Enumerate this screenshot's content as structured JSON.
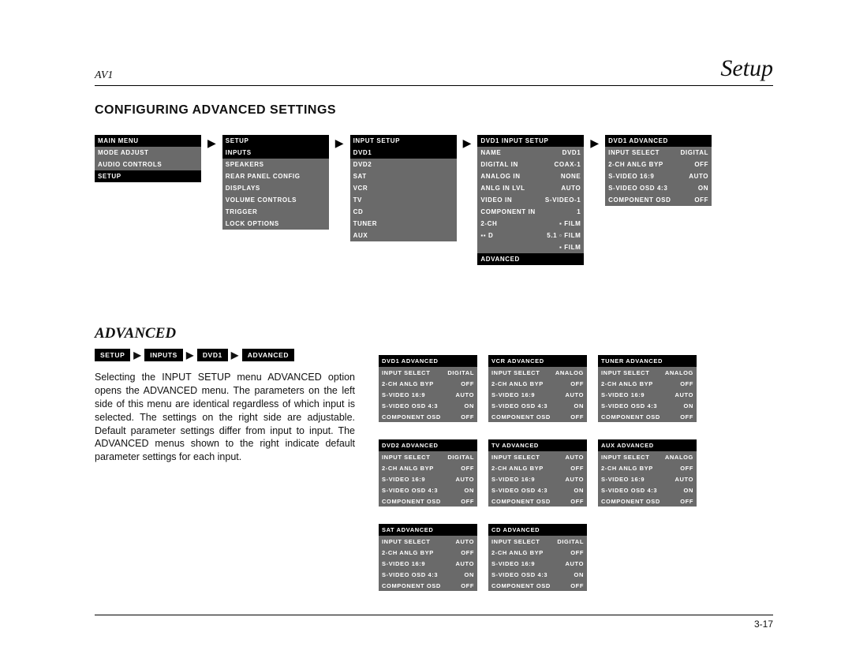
{
  "header": {
    "model": "AV1",
    "section": "Setup"
  },
  "title": "CONFIGURING ADVANCED SETTINGS",
  "breadcrumb": [
    "SETUP",
    "INPUTS",
    "DVD1",
    "ADVANCED"
  ],
  "paragraph": "Selecting the INPUT SETUP menu ADVANCED option opens the ADVANCED menu. The parameters on the left side of this menu are identical regardless of which input is selected. The settings on the right side are adjustable. Default parameter settings differ from input to input. The ADVANCED menus shown to the right indicate default parameter settings for each input.",
  "subheading": "ADVANCED",
  "page_number": "3-17",
  "menu_flow": [
    {
      "title": "MAIN MENU",
      "rows": [
        {
          "l": "MODE ADJUST"
        },
        {
          "l": "AUDIO CONTROLS"
        },
        {
          "l": "SETUP",
          "sel": true
        }
      ]
    },
    {
      "title": "SETUP",
      "rows": [
        {
          "l": "INPUTS",
          "sel": true
        },
        {
          "l": "SPEAKERS"
        },
        {
          "l": "REAR PANEL CONFIG"
        },
        {
          "l": "DISPLAYS"
        },
        {
          "l": "VOLUME CONTROLS"
        },
        {
          "l": "TRIGGER"
        },
        {
          "l": "LOCK OPTIONS"
        }
      ]
    },
    {
      "title": "INPUT SETUP",
      "rows": [
        {
          "l": "DVD1",
          "sel": true
        },
        {
          "l": "DVD2"
        },
        {
          "l": "SAT"
        },
        {
          "l": "VCR"
        },
        {
          "l": "TV"
        },
        {
          "l": "CD"
        },
        {
          "l": "TUNER"
        },
        {
          "l": "AUX"
        }
      ]
    },
    {
      "title": "DVD1 INPUT SETUP",
      "rows": [
        {
          "l": "NAME",
          "r": "DVD1"
        },
        {
          "l": "DIGITAL IN",
          "r": "COAX-1"
        },
        {
          "l": "ANALOG IN",
          "r": "NONE"
        },
        {
          "l": "ANLG IN LVL",
          "r": "AUTO"
        },
        {
          "l": "VIDEO IN",
          "r": "S-VIDEO-1"
        },
        {
          "l": "COMPONENT IN",
          "r": "1"
        },
        {
          "l": "2-CH",
          "r": "▪ FILM"
        },
        {
          "l": "▪▪ D",
          "r": "5.1 ▫ FILM"
        },
        {
          "l": "",
          "r": "▪ FILM"
        },
        {
          "l": "ADVANCED",
          "sel": true
        }
      ]
    },
    {
      "title": "DVD1 ADVANCED",
      "rows": [
        {
          "l": "INPUT SELECT",
          "r": "DIGITAL"
        },
        {
          "l": "2-CH ANLG BYP",
          "r": "OFF"
        },
        {
          "l": "S-VIDEO 16:9",
          "r": "AUTO"
        },
        {
          "l": "S-VIDEO OSD 4:3",
          "r": "ON"
        },
        {
          "l": "COMPONENT OSD",
          "r": "OFF"
        }
      ]
    }
  ],
  "adv_boxes": [
    {
      "title": "DVD1 ADVANCED",
      "rows": [
        {
          "l": "INPUT SELECT",
          "r": "DIGITAL"
        },
        {
          "l": "2-CH ANLG BYP",
          "r": "OFF"
        },
        {
          "l": "S-VIDEO 16:9",
          "r": "AUTO"
        },
        {
          "l": "S-VIDEO OSD 4:3",
          "r": "ON"
        },
        {
          "l": "COMPONENT OSD",
          "r": "OFF"
        }
      ]
    },
    {
      "title": "VCR ADVANCED",
      "rows": [
        {
          "l": "INPUT SELECT",
          "r": "ANALOG"
        },
        {
          "l": "2-CH ANLG BYP",
          "r": "OFF"
        },
        {
          "l": "S-VIDEO 16:9",
          "r": "AUTO"
        },
        {
          "l": "S-VIDEO OSD 4:3",
          "r": "ON"
        },
        {
          "l": "COMPONENT OSD",
          "r": "OFF"
        }
      ]
    },
    {
      "title": "TUNER ADVANCED",
      "rows": [
        {
          "l": "INPUT SELECT",
          "r": "ANALOG"
        },
        {
          "l": "2-CH ANLG BYP",
          "r": "OFF"
        },
        {
          "l": "S-VIDEO 16:9",
          "r": "AUTO"
        },
        {
          "l": "S-VIDEO OSD 4:3",
          "r": "ON"
        },
        {
          "l": "COMPONENT OSD",
          "r": "OFF"
        }
      ]
    },
    {
      "title": "DVD2 ADVANCED",
      "rows": [
        {
          "l": "INPUT SELECT",
          "r": "DIGITAL"
        },
        {
          "l": "2-CH ANLG BYP",
          "r": "OFF"
        },
        {
          "l": "S-VIDEO 16:9",
          "r": "AUTO"
        },
        {
          "l": "S-VIDEO OSD 4:3",
          "r": "ON"
        },
        {
          "l": "COMPONENT OSD",
          "r": "OFF"
        }
      ]
    },
    {
      "title": "TV ADVANCED",
      "rows": [
        {
          "l": "INPUT SELECT",
          "r": "AUTO"
        },
        {
          "l": "2-CH ANLG BYP",
          "r": "OFF"
        },
        {
          "l": "S-VIDEO 16:9",
          "r": "AUTO"
        },
        {
          "l": "S-VIDEO OSD 4:3",
          "r": "ON"
        },
        {
          "l": "COMPONENT OSD",
          "r": "OFF"
        }
      ]
    },
    {
      "title": "AUX ADVANCED",
      "rows": [
        {
          "l": "INPUT SELECT",
          "r": "ANALOG"
        },
        {
          "l": "2-CH ANLG BYP",
          "r": "OFF"
        },
        {
          "l": "S-VIDEO 16:9",
          "r": "AUTO"
        },
        {
          "l": "S-VIDEO OSD 4:3",
          "r": "ON"
        },
        {
          "l": "COMPONENT OSD",
          "r": "OFF"
        }
      ]
    },
    {
      "title": "SAT ADVANCED",
      "rows": [
        {
          "l": "INPUT SELECT",
          "r": "AUTO"
        },
        {
          "l": "2-CH ANLG BYP",
          "r": "OFF"
        },
        {
          "l": "S-VIDEO 16:9",
          "r": "AUTO"
        },
        {
          "l": "S-VIDEO OSD 4:3",
          "r": "ON"
        },
        {
          "l": "COMPONENT OSD",
          "r": "OFF"
        }
      ]
    },
    {
      "title": "CD ADVANCED",
      "rows": [
        {
          "l": "INPUT SELECT",
          "r": "DIGITAL"
        },
        {
          "l": "2-CH ANLG BYP",
          "r": "OFF"
        },
        {
          "l": "S-VIDEO 16:9",
          "r": "AUTO"
        },
        {
          "l": "S-VIDEO OSD 4:3",
          "r": "ON"
        },
        {
          "l": "COMPONENT OSD",
          "r": "OFF"
        }
      ]
    }
  ]
}
